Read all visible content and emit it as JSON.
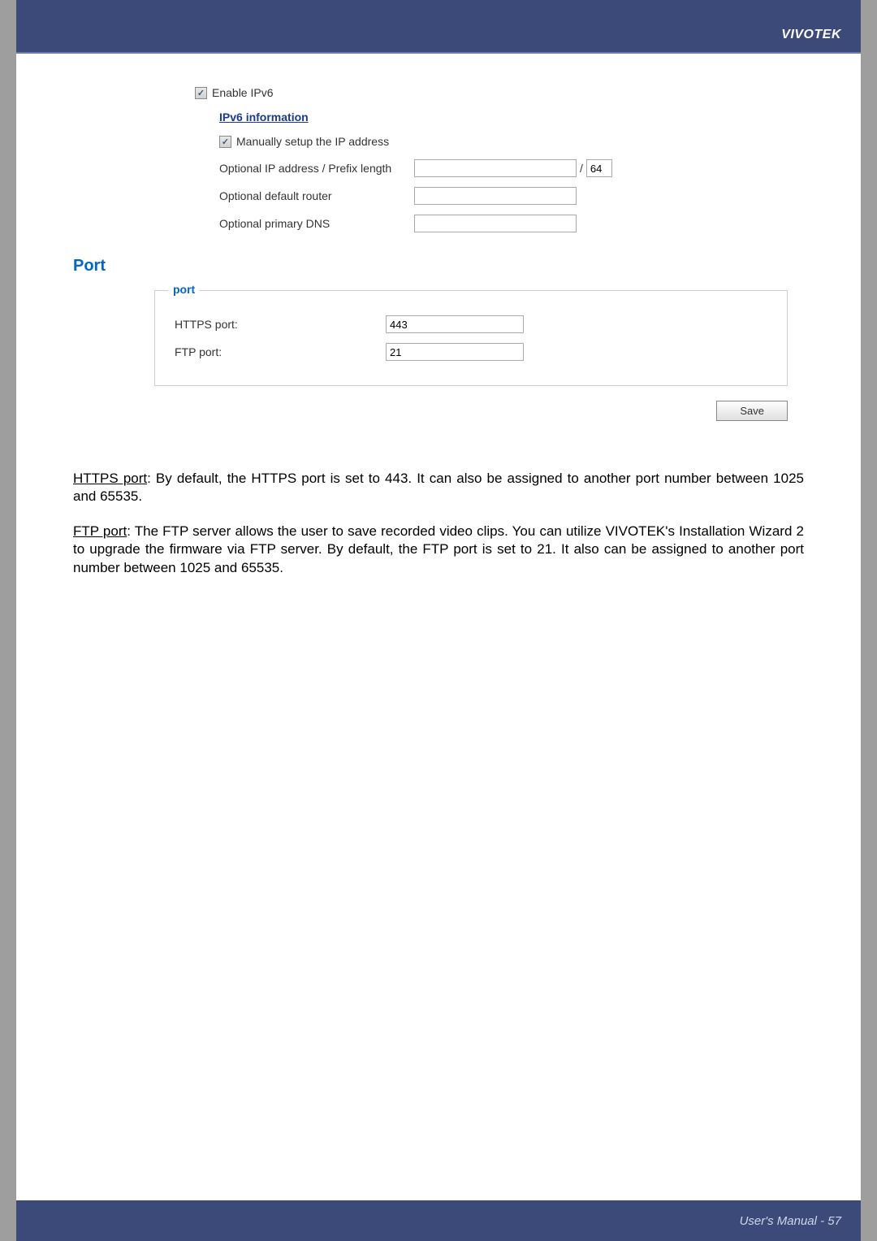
{
  "header": {
    "brand": "VIVOTEK"
  },
  "ipv6": {
    "enable_label": "Enable IPv6",
    "info_link": "IPv6 information",
    "manual_label": "Manually setup the IP address",
    "addr_label": "Optional IP address / Prefix length",
    "addr_value": "",
    "prefix_value": "64",
    "router_label": "Optional default router",
    "router_value": "",
    "dns_label": "Optional primary DNS",
    "dns_value": ""
  },
  "port_section": {
    "heading": "Port",
    "legend": "port",
    "https_label": "HTTPS port:",
    "https_value": "443",
    "ftp_label": "FTP port:",
    "ftp_value": "21",
    "save": "Save"
  },
  "body": {
    "p1_u": "HTTPS port",
    "p1_rest": ": By default, the HTTPS port is set to 443. It can also be assigned to another port number between 1025 and 65535.",
    "p2_u": "FTP port",
    "p2_rest": ": The FTP server allows the user to save recorded video clips. You can utilize VIVOTEK's Installation Wizard 2 to upgrade the firmware via FTP server. By default, the FTP port is set to 21. It also can be assigned to another port number between 1025 and 65535."
  },
  "footer": {
    "text": "User's Manual - 57"
  }
}
